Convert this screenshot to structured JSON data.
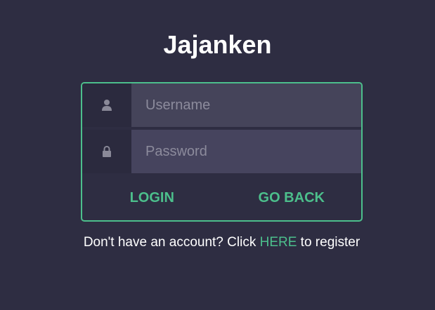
{
  "app": {
    "title": "Jajanken"
  },
  "login_form": {
    "username": {
      "icon": "user-icon",
      "value": "",
      "placeholder": "Username"
    },
    "password": {
      "icon": "lock-icon",
      "value": "",
      "placeholder": "Password"
    },
    "login_label": "LOGIN",
    "go_back_label": "GO BACK"
  },
  "footer": {
    "prefix": "Don't have an account? Click ",
    "link_label": "HERE",
    "suffix": " to register"
  },
  "colors": {
    "background": "#2e2d42",
    "accent": "#4cbf8c",
    "input_background": "#45445a",
    "icon_background": "#2b2a3e",
    "text": "#ffffff"
  }
}
